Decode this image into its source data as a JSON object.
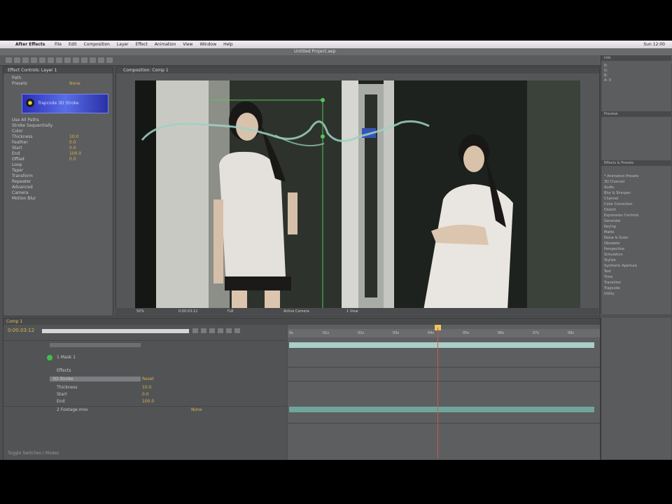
{
  "menubar": {
    "app_name": "After Effects",
    "items": [
      "File",
      "Edit",
      "Composition",
      "Layer",
      "Effect",
      "Animation",
      "View",
      "Window",
      "Help"
    ],
    "clock": "Sun 12:00"
  },
  "window": {
    "title": "Untitled Project.aep"
  },
  "left_panel": {
    "tab": "Effect Controls: Layer 1",
    "effect_name": "Trapcode 3D Stroke",
    "properties": [
      {
        "label": "Path",
        "value": ""
      },
      {
        "label": "Presets",
        "value": "None"
      },
      {
        "label": "Use All Paths",
        "value": ""
      },
      {
        "label": "Stroke Sequentially",
        "value": ""
      },
      {
        "label": "Color",
        "value": ""
      },
      {
        "label": "Thickness",
        "value": "10.0"
      },
      {
        "label": "Feather",
        "value": "0.0"
      },
      {
        "label": "Start",
        "value": "0.0"
      },
      {
        "label": "End",
        "value": "100.0"
      },
      {
        "label": "Offset",
        "value": "0.0"
      },
      {
        "label": "Loop",
        "value": ""
      },
      {
        "label": "Taper",
        "value": ""
      },
      {
        "label": "Transform",
        "value": ""
      },
      {
        "label": "Repeater",
        "value": ""
      },
      {
        "label": "Advanced",
        "value": ""
      },
      {
        "label": "Camera",
        "value": ""
      },
      {
        "label": "Motion Blur",
        "value": ""
      }
    ]
  },
  "viewer": {
    "tab": "Composition: Comp 1",
    "zoom": "50%",
    "timecode": "0:00:03:12",
    "resolution": "Full",
    "camera": "Active Camera",
    "views": "1 View"
  },
  "right_panel": {
    "info_tab": "Info",
    "info_lines": [
      "R:",
      "G:",
      "B:",
      "A: 0"
    ],
    "preview_tab": "Preview",
    "effects_tab": "Effects & Presets",
    "effect_categories": [
      "* Animation Presets",
      "3D Channel",
      "Audio",
      "Blur & Sharpen",
      "Channel",
      "Color Correction",
      "Distort",
      "Expression Controls",
      "Generate",
      "Keying",
      "Matte",
      "Noise & Grain",
      "Obsolete",
      "Perspective",
      "Simulation",
      "Stylize",
      "Synthetic Aperture",
      "Text",
      "Time",
      "Transition",
      "Trapcode",
      "Utility"
    ]
  },
  "timeline": {
    "tab": "Comp 1",
    "timecode": "0:00:03:12",
    "ruler_ticks": [
      "0s",
      "01s",
      "02s",
      "03s",
      "04s",
      "05s",
      "06s",
      "07s",
      "08s"
    ],
    "layers": [
      {
        "label": "1  Mask 1",
        "value": ""
      },
      {
        "label": "Effects",
        "value": ""
      },
      {
        "label": "3D Stroke",
        "value": "Reset"
      },
      {
        "label": "Thickness",
        "value": "10.0"
      },
      {
        "label": "Start",
        "value": "0.0"
      },
      {
        "label": "End",
        "value": "100.0"
      },
      {
        "label": "2  Footage.mov",
        "value": "None"
      }
    ],
    "toggle_label": "Toggle Switches / Modes"
  },
  "colors": {
    "accent": "#d9b54e",
    "cti": "#d2564f",
    "layer_bar": "#a9cfc7"
  }
}
